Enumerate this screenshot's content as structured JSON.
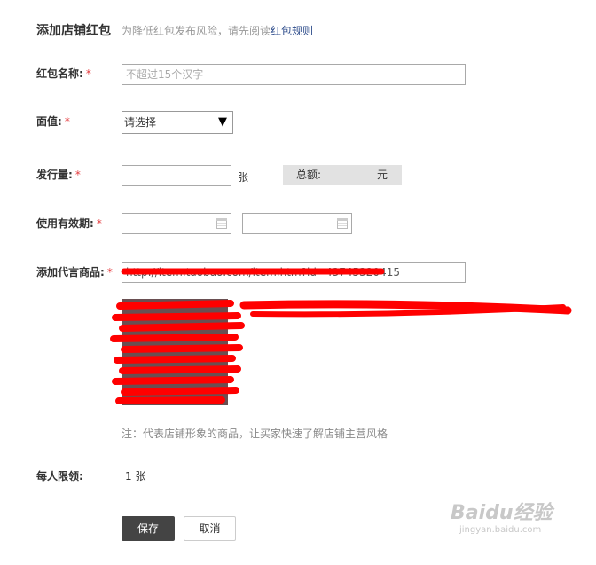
{
  "header": {
    "title": "添加店铺红包",
    "note_prefix": "为降低红包发布风险，请先阅读",
    "note_link": "红包规则"
  },
  "form": {
    "name": {
      "label": "红包名称:",
      "placeholder": "不超过15个汉字",
      "value": ""
    },
    "face_value": {
      "label": "面值:",
      "selected": "请选择"
    },
    "quantity": {
      "label": "发行量:",
      "unit": "张",
      "total_label": "总额:",
      "total_unit": "元"
    },
    "validity": {
      "label": "使用有效期:",
      "separator": "-"
    },
    "product": {
      "label": "添加代言商品:",
      "value": "http://item.taobao.com/item.htm?id=43745320415"
    },
    "hint": "注：代表店铺形象的商品，让买家快速了解店铺主营风格",
    "limit": {
      "label": "每人限领:",
      "value": "1 张"
    },
    "required_mark": "*"
  },
  "buttons": {
    "save": "保存",
    "cancel": "取消"
  },
  "watermark": {
    "brand": "Baidu经验",
    "url": "jingyan.baidu.com"
  },
  "colors": {
    "required": "#e4393c",
    "link": "#2b4a8a",
    "save_bg": "#444444",
    "total_bg": "#e2e2e2",
    "redaction": "#ff0000"
  }
}
